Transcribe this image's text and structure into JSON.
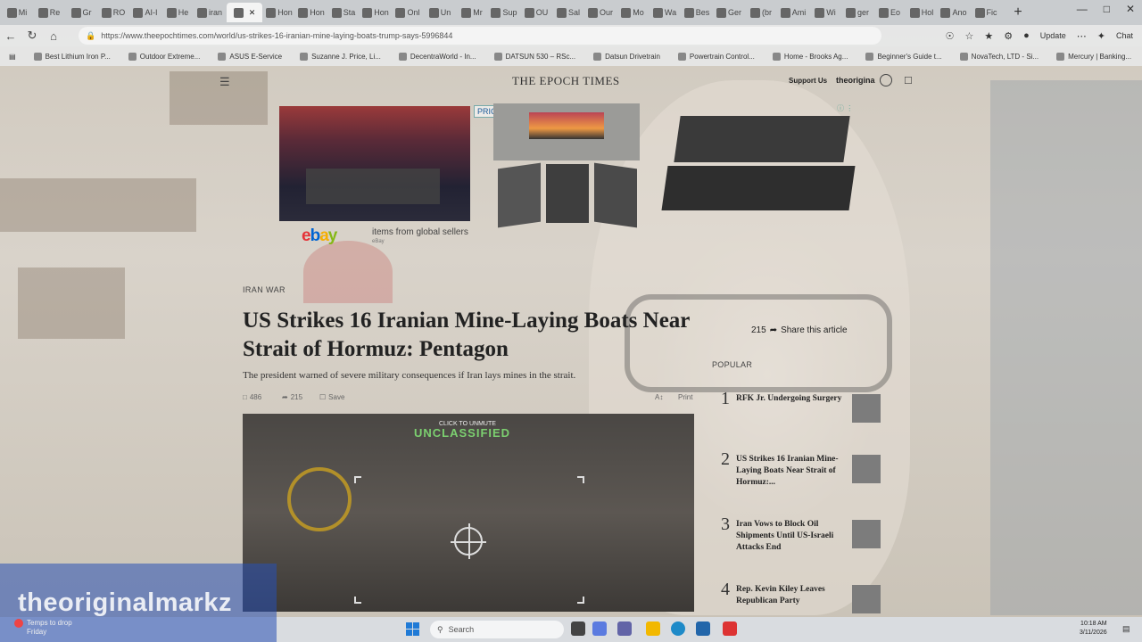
{
  "browser": {
    "tabs": [
      "Mi",
      "Re",
      "Gr",
      "RO",
      "AI-I",
      "He",
      "iran",
      "",
      "Hon",
      "Hon",
      "Sta",
      "Hon",
      "Onl",
      "Un",
      "Mr",
      "Sup",
      "OU",
      "Sal",
      "Our",
      "Mo",
      "Wa",
      "Bes",
      "Ger",
      "(br",
      "Ami",
      "Wi",
      "ger",
      "Eo",
      "Hol",
      "Ano",
      "Fic"
    ],
    "active_tab_index": 7,
    "url": "https://www.theepochtimes.com/world/us-strikes-16-iranian-mine-laying-boats-trump-says-5996844",
    "update_label": "Update",
    "chat_label": "Chat"
  },
  "bookmarks": [
    "Best Lithium Iron P...",
    "Outdoor Extreme...",
    "ASUS E-Service",
    "Suzanne J. Price, Li...",
    "DecentraWorld - In...",
    "DATSUN 530 – RSc...",
    "Datsun Drivetrain",
    "Powertrain Control...",
    "Home - Brooks Ag...",
    "Beginner's Guide t...",
    "NovaTech, LTD - Si...",
    "Mercury | Banking..."
  ],
  "site": {
    "logo": "THE EPOCH TIMES",
    "support": "Support Us",
    "user": "theorigina"
  },
  "ad": {
    "price_drop": "PRICE DROP",
    "ebay": {
      "e": "e",
      "b": "b",
      "a": "a",
      "y": "y"
    },
    "text": "items from global sellers",
    "sub": "eBay"
  },
  "article": {
    "category": "IRAN WAR",
    "headline": "US Strikes 16 Iranian Mine-Laying Boats Near Strait of Hormuz: Pentagon",
    "subhead": "The president warned of severe military consequences if Iran lays mines in the strait.",
    "comments": "486",
    "shares": "215",
    "save": "Save",
    "print": "Print",
    "video": {
      "unmute": "CLICK TO UNMUTE",
      "banner": "UNCLASSIFIED"
    }
  },
  "share": {
    "count": "215",
    "label": "Share this article"
  },
  "popular": {
    "title": "POPULAR",
    "items": [
      {
        "num": "1",
        "title": "RFK Jr. Undergoing Surgery"
      },
      {
        "num": "2",
        "title": "US Strikes 16 Iranian Mine-Laying Boats Near Strait of Hormuz:..."
      },
      {
        "num": "3",
        "title": "Iran Vows to Block Oil Shipments Until US-Israeli Attacks End"
      },
      {
        "num": "4",
        "title": "Rep. Kevin Kiley Leaves Republican Party"
      }
    ]
  },
  "watermark": "theoriginalmarkz",
  "weather": {
    "line1": "Temps to drop",
    "line2": "Friday"
  },
  "taskbar": {
    "search": "Search",
    "time": "10:18 AM",
    "date": "3/11/2026"
  },
  "colors": {
    "ebay_e": "#e53238",
    "ebay_b": "#0064d2",
    "ebay_a": "#f5af02",
    "ebay_y": "#86b817",
    "watermark_bg": "#2850b4"
  }
}
